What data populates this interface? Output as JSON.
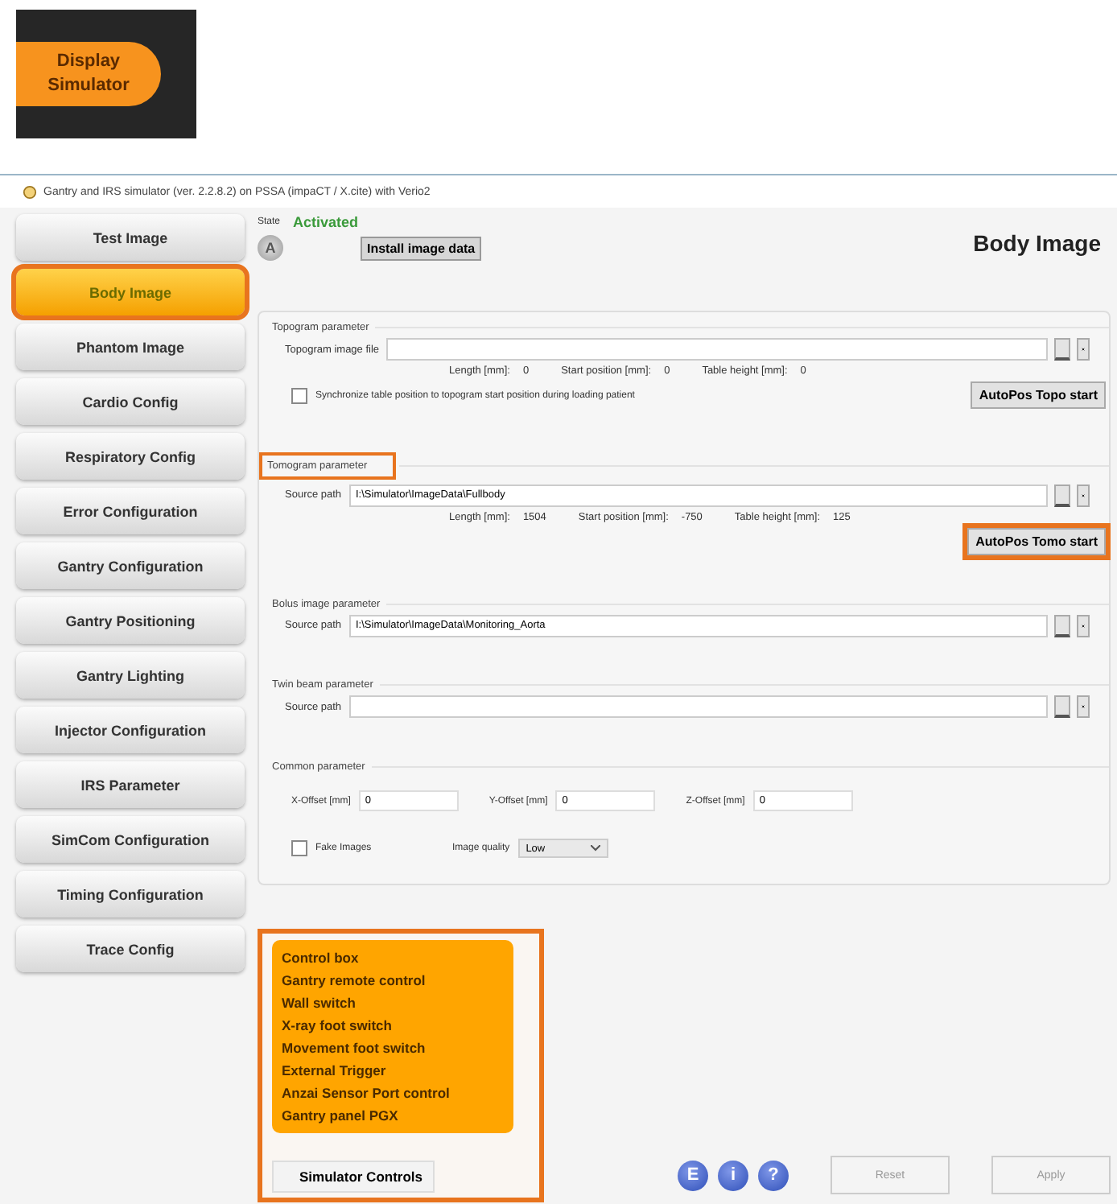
{
  "badge": {
    "text": "Display Simulator"
  },
  "window": {
    "title": "Gantry and IRS simulator (ver. 2.2.8.2) on PSSA (impaCT / X.cite) with Verio2"
  },
  "sidebar": {
    "items": [
      {
        "label": "Test Image",
        "selected": false,
        "highlighted": false
      },
      {
        "label": "Body Image",
        "selected": true,
        "highlighted": true
      },
      {
        "label": "Phantom Image",
        "selected": false,
        "highlighted": false
      },
      {
        "label": "Cardio Config",
        "selected": false,
        "highlighted": false
      },
      {
        "label": "Respiratory Config",
        "selected": false,
        "highlighted": false
      },
      {
        "label": "Error Configuration",
        "selected": false,
        "highlighted": false
      },
      {
        "label": "Gantry Configuration",
        "selected": false,
        "highlighted": false
      },
      {
        "label": "Gantry Positioning",
        "selected": false,
        "highlighted": false
      },
      {
        "label": "Gantry Lighting",
        "selected": false,
        "highlighted": false
      },
      {
        "label": "Injector Configuration",
        "selected": false,
        "highlighted": false
      },
      {
        "label": "IRS Parameter",
        "selected": false,
        "highlighted": false
      },
      {
        "label": "SimCom Configuration",
        "selected": false,
        "highlighted": false
      },
      {
        "label": "Timing Configuration",
        "selected": false,
        "highlighted": false
      },
      {
        "label": "Trace Config",
        "selected": false,
        "highlighted": false
      }
    ]
  },
  "header": {
    "state_label": "State",
    "state_value": "Activated",
    "avatar": "A",
    "install_button": "Install image data",
    "page_title": "Body Image"
  },
  "groups": [
    {
      "kind": "file",
      "title": "Topogram parameter",
      "title_highlighted": false,
      "field_label": "Topogram image file",
      "readings": [
        {
          "label": "Length [mm]:",
          "value": "0"
        },
        {
          "label": "Start position [mm]:",
          "value": "0"
        },
        {
          "label": "Table height [mm]:",
          "value": "0"
        }
      ],
      "checkbox": {
        "label": "Synchronize table position to topogram start position during loading patient",
        "checked": false
      },
      "button": {
        "label": "AutoPos Topo start",
        "highlighted": false
      }
    },
    {
      "kind": "file",
      "title": "Tomogram parameter",
      "title_highlighted": true,
      "field_label": "Source path",
      "field_value": "I:\\Simulator\\ImageData\\Fullbody",
      "readings": [
        {
          "label": "Length [mm]:",
          "value": "1504"
        },
        {
          "label": "Start position [mm]:",
          "value": "-750"
        },
        {
          "label": "Table height [mm]:",
          "value": "125"
        }
      ],
      "button": {
        "label": "AutoPos Tomo start",
        "highlighted": true
      }
    },
    {
      "kind": "file",
      "title": "Bolus image parameter",
      "title_highlighted": false,
      "field_label": "Source path",
      "field_value": "I:\\Simulator\\ImageData\\Monitoring_Aorta"
    },
    {
      "kind": "file",
      "title": "Twin beam parameter",
      "title_highlighted": false,
      "field_label": "Source path"
    },
    {
      "kind": "common",
      "title": "Common parameter",
      "title_highlighted": false,
      "offsets": [
        {
          "label": "X-Offset [mm]",
          "value": "0"
        },
        {
          "label": "Y-Offset [mm]",
          "value": "0"
        },
        {
          "label": "Z-Offset [mm]",
          "value": "0"
        }
      ],
      "checkbox": {
        "label": "Fake Images",
        "checked": false
      },
      "quality": {
        "label": "Image quality",
        "value": "Low"
      }
    }
  ],
  "popup_menu": {
    "items": [
      "Control box",
      "Gantry remote control",
      "Wall switch",
      "X-ray foot switch",
      "Movement foot switch",
      "External Trigger",
      "Anzai Sensor Port control",
      "Gantry panel PGX"
    ],
    "button": "Simulator Controls"
  },
  "footer": {
    "icons": [
      "E",
      "i",
      "?"
    ],
    "buttons": [
      {
        "label": "Reset",
        "disabled": true
      },
      {
        "label": "Apply",
        "disabled": true
      }
    ]
  }
}
